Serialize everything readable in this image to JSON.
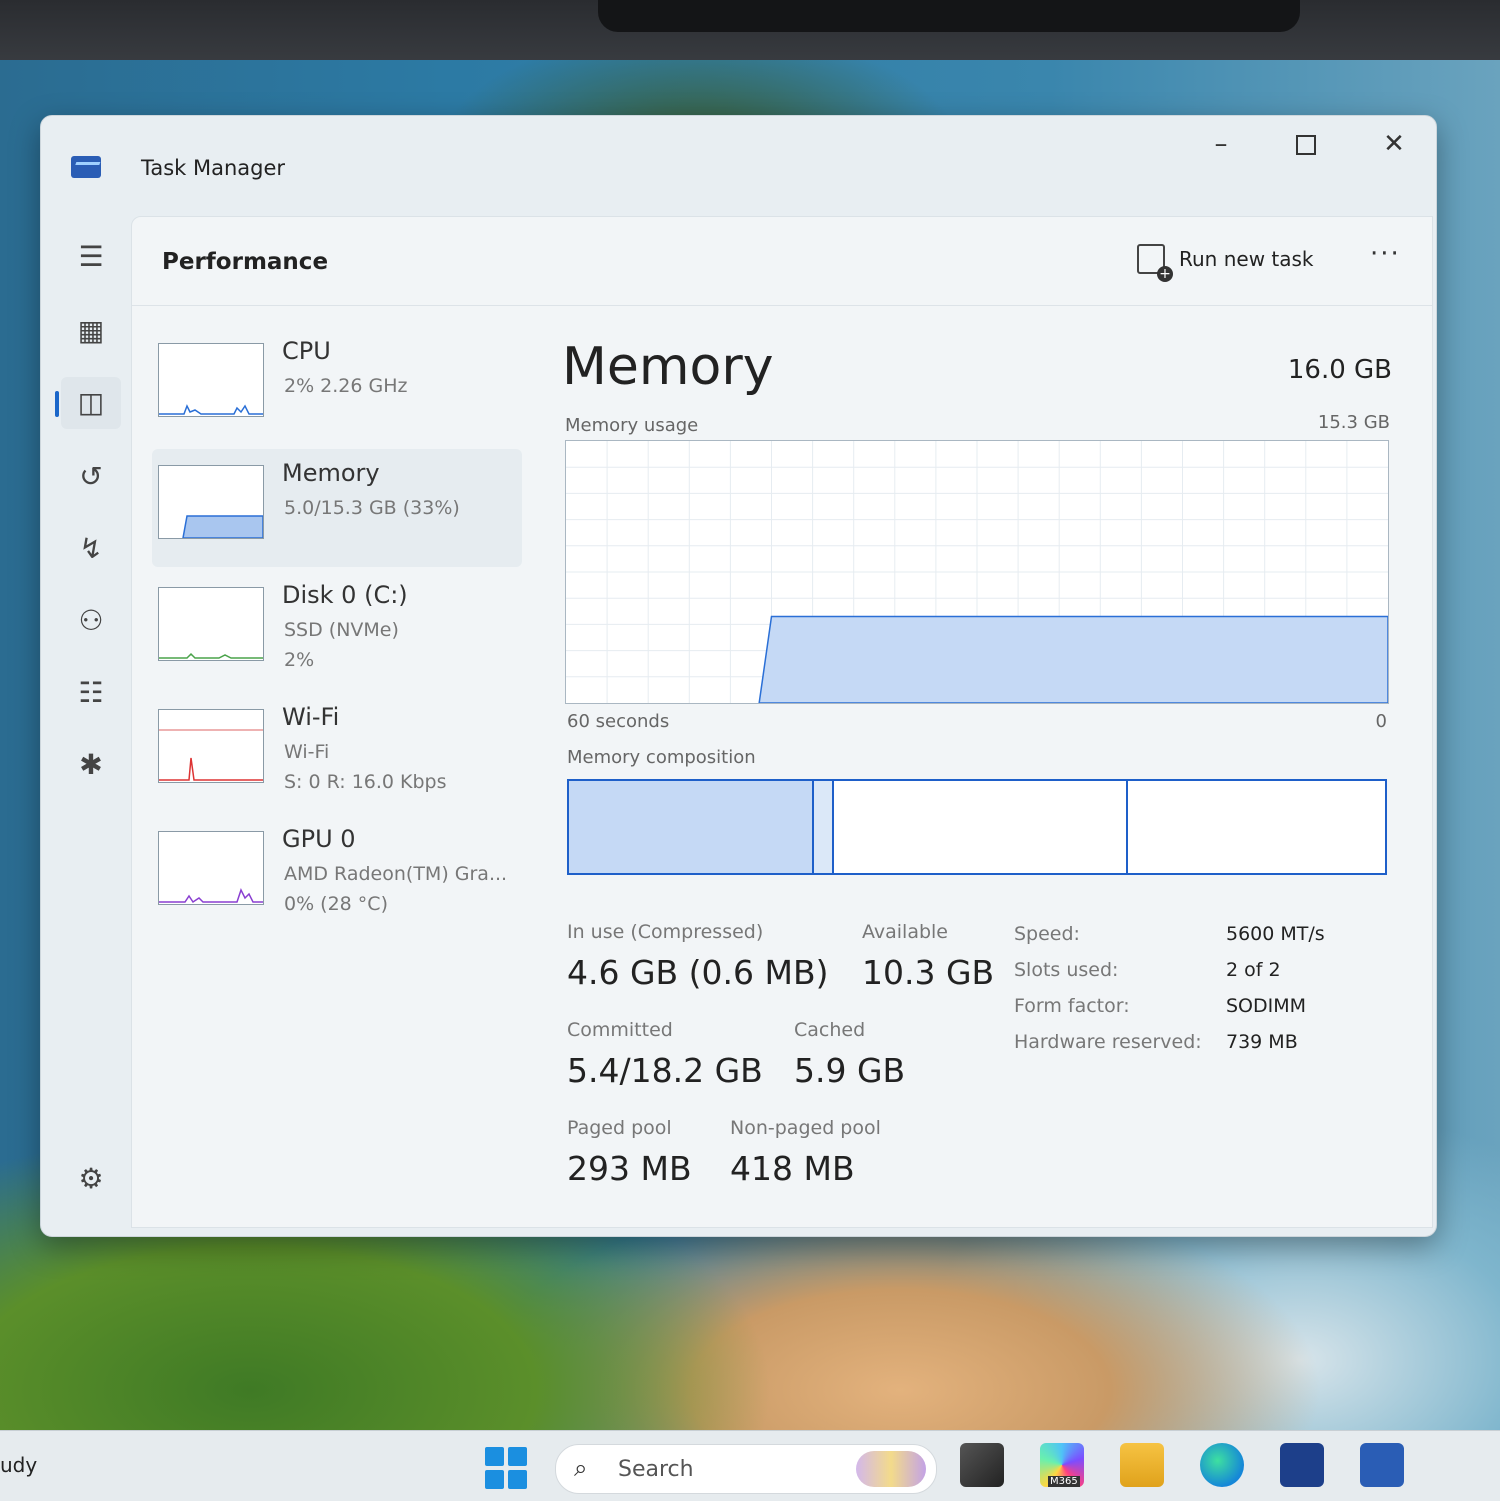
{
  "window": {
    "title": "Task Manager"
  },
  "taskbar": {
    "left_label": "udy",
    "search_label": "Search",
    "m365_label": "M365"
  },
  "header": {
    "page_title": "Performance",
    "run_new_task": "Run new task",
    "more": "···"
  },
  "devices": [
    {
      "name": "CPU",
      "line1": "2%  2.26 GHz",
      "line2": ""
    },
    {
      "name": "Memory",
      "line1": "5.0/15.3 GB (33%)",
      "line2": ""
    },
    {
      "name": "Disk 0 (C:)",
      "line1": "SSD (NVMe)",
      "line2": "2%"
    },
    {
      "name": "Wi-Fi",
      "line1": "Wi-Fi",
      "line2": "S: 0  R: 16.0 Kbps"
    },
    {
      "name": "GPU 0",
      "line1": "AMD Radeon(TM) Gra...",
      "line2": "0%  (28 °C)"
    }
  ],
  "memory": {
    "title": "Memory",
    "total": "16.0 GB",
    "usage_label": "Memory usage",
    "usage_max": "15.3 GB",
    "axis_left": "60 seconds",
    "axis_right": "0",
    "composition_label": "Memory composition",
    "usage_fraction": 0.33,
    "composition": {
      "in_use": 0.3,
      "modified": 0.025,
      "standby": 0.36,
      "free": 0.315
    },
    "stats": {
      "in_use_label": "In use (Compressed)",
      "in_use_value": "4.6 GB (0.6 MB)",
      "available_label": "Available",
      "available_value": "10.3 GB",
      "committed_label": "Committed",
      "committed_value": "5.4/18.2 GB",
      "cached_label": "Cached",
      "cached_value": "5.9 GB",
      "paged_label": "Paged pool",
      "paged_value": "293 MB",
      "nonpaged_label": "Non-paged pool",
      "nonpaged_value": "418 MB"
    },
    "specs": {
      "speed_label": "Speed:",
      "speed_value": "5600 MT/s",
      "slots_label": "Slots used:",
      "slots_value": "2 of 2",
      "form_label": "Form factor:",
      "form_value": "SODIMM",
      "hw_label": "Hardware reserved:",
      "hw_value": "739 MB"
    }
  },
  "colors": {
    "accent": "#1e5fc9",
    "fill": "#c5d9f5",
    "line": "#2a6fd6"
  }
}
